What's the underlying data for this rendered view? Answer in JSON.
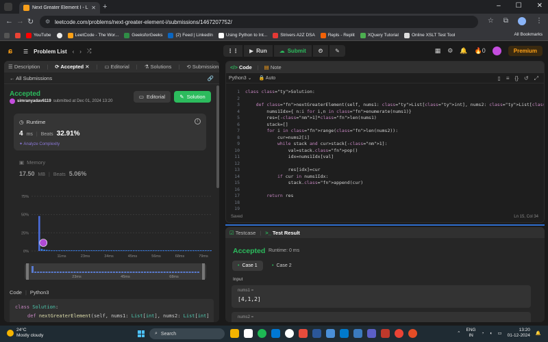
{
  "browser": {
    "tab_title": "Next Greater Element I - LeetC...",
    "url": "leetcode.com/problems/next-greater-element-i/submissions/1467207752/",
    "bookmarks": [
      "YouTube",
      "LeetCode - The Wor...",
      "GeeksforGeeks",
      "(2) Feed | LinkedIn",
      "Using Python to Int...",
      "Strivers A2Z DSA",
      "Repls - Replit",
      "XQuery Tutorial",
      "Online XSLT Test Tool"
    ],
    "all_bookmarks": "All Bookmarks"
  },
  "nav": {
    "problem_list": "Problem List",
    "run": "Run",
    "submit": "Submit",
    "streak": "0",
    "premium": "Premium"
  },
  "left": {
    "tabs": [
      "Description",
      "Accepted",
      "Editorial",
      "Solutions",
      "Submissions"
    ],
    "all_submissions": "All Submissions",
    "status": "Accepted",
    "user": "simranyadav6119",
    "submitted_at": "submitted at Dec 01, 2024 13:20",
    "editorial_btn": "Editorial",
    "solution_btn": "Solution",
    "runtime_label": "Runtime",
    "runtime_value": "4",
    "runtime_unit": "ms",
    "beats_label": "Beats",
    "runtime_beats": "32.91%",
    "analyze": "Analyze Complexity",
    "memory_label": "Memory",
    "memory_value": "17.50",
    "memory_unit": "MB",
    "memory_beats": "5.06%",
    "code_label": "Code",
    "code_lang": "Python3",
    "code_preview": [
      "class Solution:",
      "    def nextGreaterElement(self, nums1: List[int], nums2: List[int])"
    ]
  },
  "chart_data": {
    "type": "bar",
    "y_ticks": [
      "75%",
      "50%",
      "25%",
      "0%"
    ],
    "x_ticks": [
      "11ms",
      "23ms",
      "34ms",
      "45ms",
      "56ms",
      "68ms",
      "79ms"
    ],
    "brush_ticks": [
      "23ms",
      "45ms",
      "68ms"
    ],
    "ylim": [
      0,
      75
    ],
    "values": [
      48,
      3,
      2,
      1.5,
      1.2,
      1,
      1,
      1,
      1,
      1,
      1,
      1,
      1,
      1,
      1,
      1,
      1,
      1,
      1,
      1,
      1,
      1,
      1,
      1,
      1,
      1,
      1,
      1,
      1,
      1,
      1,
      1,
      1,
      1,
      1,
      1,
      1,
      1,
      1,
      1,
      1,
      1,
      1,
      1,
      1,
      1,
      1,
      1,
      1,
      1,
      1,
      1,
      1,
      1,
      1,
      1,
      1,
      1,
      1,
      1,
      1,
      1,
      1,
      1,
      1,
      1,
      1,
      1,
      1,
      1
    ],
    "highlight_index": 2
  },
  "editor": {
    "tabs": [
      "Code",
      "Note"
    ],
    "language": "Python3",
    "mode": "Auto",
    "saved": "Saved",
    "cursor": "Ln 15, Col 34",
    "lines": [
      "class Solution:",
      "",
      "    def nextGreaterElement(self, nums1: List[int], nums2: List[int]) -> List[int]:",
      "        nums1Idx={ n:i for i,n in enumerate(nums1)}",
      "        res=[-1]*len(nums1)",
      "        stack=[]",
      "        for i in range(len(nums2)):",
      "            cur=nums2[i]",
      "            while stack and cur>stack[-1]:",
      "                val=stack.pop()",
      "                idx=nums1Idx[val]",
      "",
      "                res[idx]=cur",
      "            if cur in nums1Idx:",
      "                stack.append(cur)",
      "",
      "        return res",
      "",
      ""
    ]
  },
  "result": {
    "tabs": [
      "Testcase",
      "Test Result"
    ],
    "status": "Accepted",
    "runtime": "Runtime: 0 ms",
    "cases": [
      "Case 1",
      "Case 2"
    ],
    "input_label": "Input",
    "var1_name": "nums1 =",
    "var1_value": "[4,1,2]",
    "var2_name": "nums2 ="
  },
  "taskbar": {
    "temp": "24°C",
    "weather": "Mostly cloudy",
    "search": "Search",
    "lang1": "ENG",
    "lang2": "IN",
    "time": "13:20",
    "date": "01-12-2024"
  }
}
